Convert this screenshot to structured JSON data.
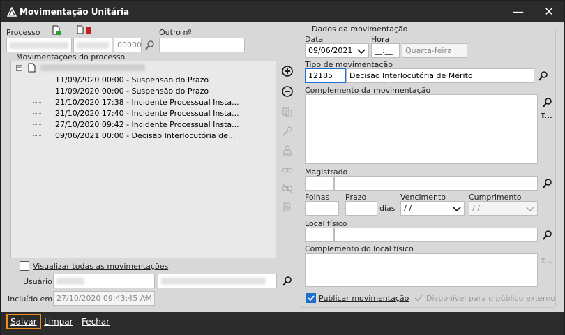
{
  "window": {
    "title": "Movimentação Unitária",
    "minimize": "—",
    "close": "✕"
  },
  "left": {
    "processo_label": "Processo",
    "processo_number": "00000",
    "outro_label": "Outro nº",
    "movs_label": "Movimentações do processo",
    "tree_rows": [
      "11/09/2020 00:00 - Suspensão do Prazo",
      "11/09/2020 00:00 - Suspensão do Prazo",
      "21/10/2020 17:38 - Incidente Processual Insta...",
      "21/10/2020 17:40 - Incidente Processual Insta...",
      "27/10/2020 09:42 - Incidente Processual Insta...",
      "09/06/2021 00:00 - Decisão Interlocutória de..."
    ],
    "visualizar_label": "Visualizar todas as movimentações",
    "usuario_label": "Usuário",
    "incluido_label": "Incluído em :",
    "incluido_value": "27/10/2020 09:43:45 AM"
  },
  "right": {
    "group_title": "Dados da movimentação",
    "data_label": "Data",
    "data_value": "09/06/2021",
    "hora_label": "Hora",
    "hora_value": "__:__",
    "weekday": "Quarta-feira",
    "tipo_label": "Tipo de movimentação",
    "tipo_code": "12185",
    "tipo_desc": "Decisão Interlocutória de Mérito",
    "complemento_label": "Complemento da movimentação",
    "t_button": "T...",
    "magistrado_label": "Magistrado",
    "folhas_label": "Folhas",
    "prazo_label": "Prazo",
    "dias_label": "dias",
    "vencimento_label": "Vencimento",
    "vencimento_value": " / /",
    "cumprimento_label": "Cumprimento",
    "cumprimento_value": " / /",
    "local_label": "Local físico",
    "complemento_local_label": "Complemento do local físico",
    "publicar_label": "Publicar movimentação",
    "disponivel_label": "Disponível para o público externo"
  },
  "footer": {
    "salvar": "Salvar",
    "limpar": "Limpar",
    "fechar": "Fechar"
  }
}
